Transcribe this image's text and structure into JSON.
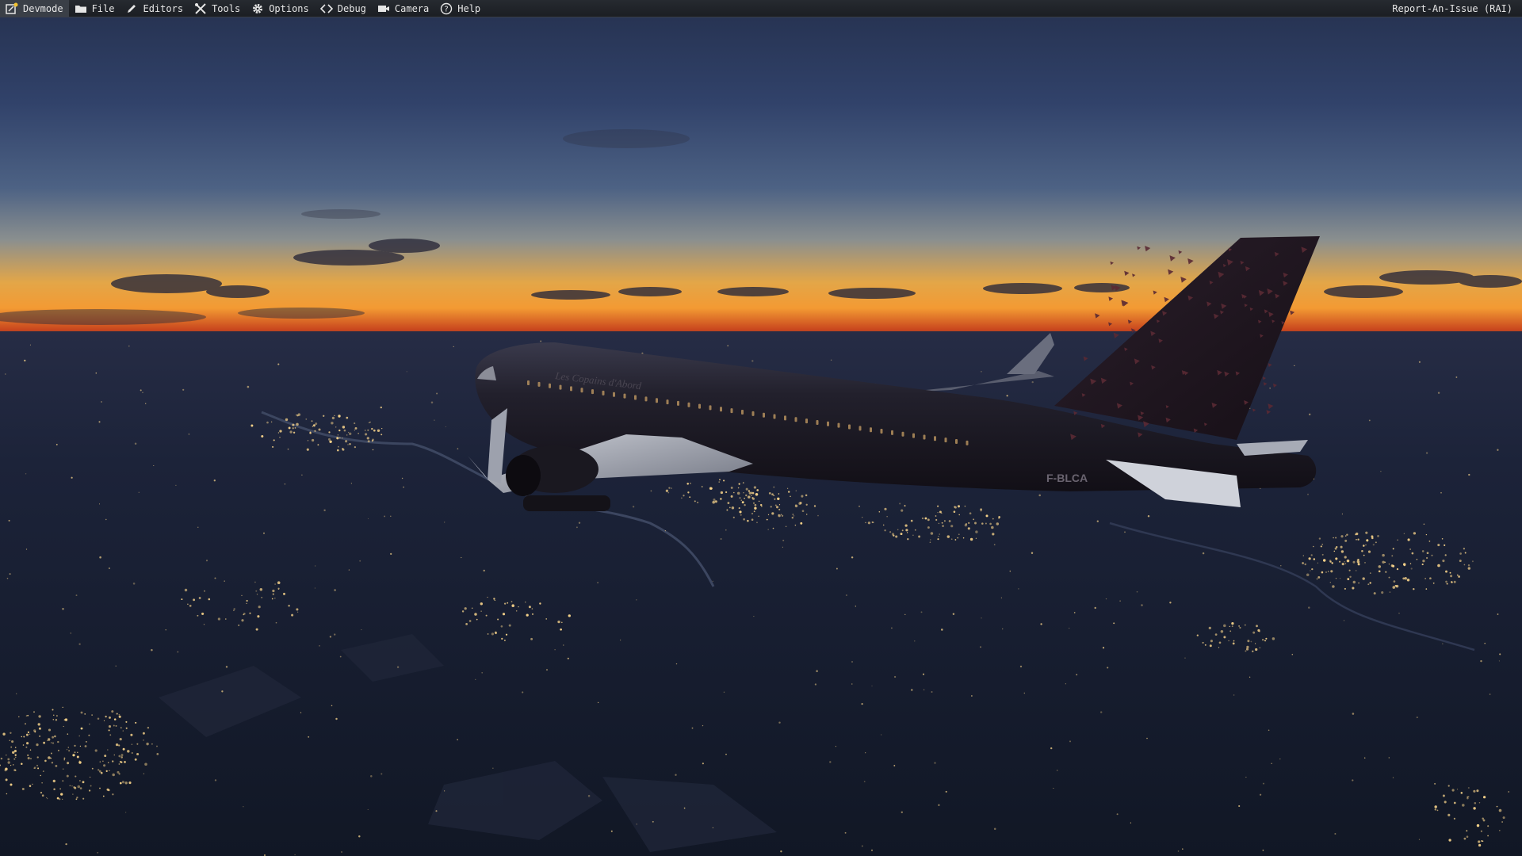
{
  "menubar": {
    "items": [
      {
        "label": "Devmode",
        "icon": "devmode-icon"
      },
      {
        "label": "File",
        "icon": "folder-icon"
      },
      {
        "label": "Editors",
        "icon": "pencil-icon"
      },
      {
        "label": "Tools",
        "icon": "tools-icon"
      },
      {
        "label": "Options",
        "icon": "gear-icon"
      },
      {
        "label": "Debug",
        "icon": "code-icon"
      },
      {
        "label": "Camera",
        "icon": "camera-icon"
      },
      {
        "label": "Help",
        "icon": "help-icon"
      }
    ],
    "right_label": "Report-An-Issue (RAI)"
  },
  "scene": {
    "aircraft_titles": "Les Copains d'Abord",
    "aircraft_registration": "F-BLCA",
    "colors": {
      "sky_top": "#2b3a5e",
      "sky_mid": "#4d6284",
      "horizon_glow": "#f39a33",
      "horizon_red": "#c9471e",
      "ground": "#151c30",
      "city_lights": "#f7d38a",
      "fuselage": "#1c1a24",
      "tail_accent": "#3a1f2a"
    }
  }
}
